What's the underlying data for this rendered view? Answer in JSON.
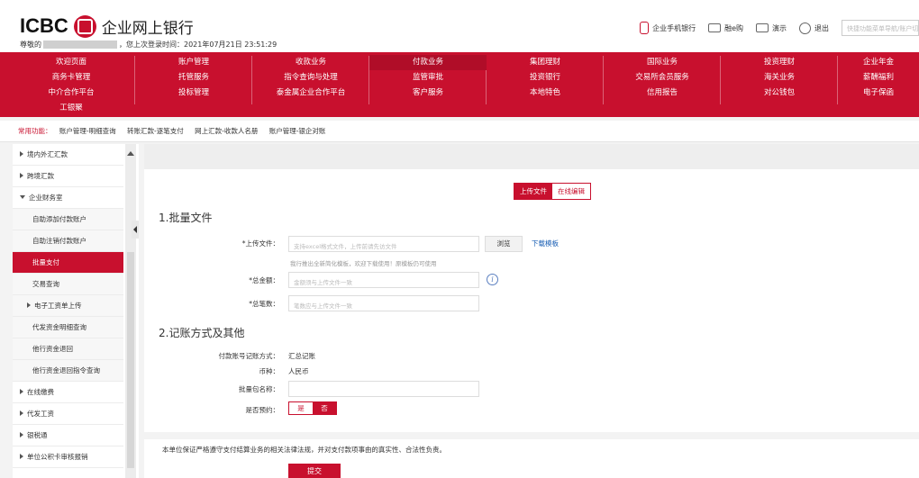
{
  "header": {
    "logo_en": "ICBC",
    "logo_cn": "企业网上银行",
    "greeting_prefix": "尊敬的",
    "last_login_text": "，您上次登录时间：2021年07月21日 23:51:29",
    "links": [
      {
        "label": "企业手机银行",
        "icon": "mobile-phone-icon"
      },
      {
        "label": "融e购",
        "icon": "mail-icon"
      },
      {
        "label": "演示",
        "icon": "demo-icon"
      },
      {
        "label": "退出",
        "icon": "power-icon"
      }
    ],
    "search_placeholder": "快捷功能菜单导航/账户切换"
  },
  "nav": {
    "rows": [
      [
        "欢迎页面",
        "账户管理",
        "收款业务",
        "付款业务",
        "集团理财",
        "国际业务",
        "投资理财",
        "企业年金"
      ],
      [
        "商务卡管理",
        "托管服务",
        "指令查询与处理",
        "监管审批",
        "投资银行",
        "交易所会员服务",
        "海关业务",
        "薪酬福利"
      ],
      [
        "中介合作平台",
        "投标管理",
        "泰金属企业合作平台",
        "客户服务",
        "本地特色",
        "信用报告",
        "对公钱包",
        "电子保函"
      ],
      [
        "工银聚"
      ]
    ],
    "active": "付款业务"
  },
  "quick": {
    "label": "常用功能：",
    "items": [
      "账户管理-明细查询",
      "转账汇款-逐笔支付",
      "网上汇款-收款人名册",
      "账户管理-银企对账"
    ]
  },
  "sidebar": {
    "items": [
      {
        "label": "境内外汇汇款",
        "level": 0,
        "arrow": "right"
      },
      {
        "label": "跨境汇款",
        "level": 0,
        "arrow": "right"
      },
      {
        "label": "企业财务室",
        "level": 0,
        "arrow": "down"
      },
      {
        "label": "自助添加付款账户",
        "level": 1
      },
      {
        "label": "自助注销付款账户",
        "level": 1
      },
      {
        "label": "批量支付",
        "level": 1,
        "active": true
      },
      {
        "label": "交易查询",
        "level": 1
      },
      {
        "label": "电子工资单上传",
        "level": 1,
        "arrow": "right"
      },
      {
        "label": "代发资金明细查询",
        "level": 1
      },
      {
        "label": "他行资金退回",
        "level": 1
      },
      {
        "label": "他行资金退回指令查询",
        "level": 1
      },
      {
        "label": "在线缴费",
        "level": 0,
        "arrow": "right"
      },
      {
        "label": "代发工资",
        "level": 0,
        "arrow": "right"
      },
      {
        "label": "银税通",
        "level": 0,
        "arrow": "right"
      },
      {
        "label": "单位公积卡审核报销",
        "level": 0,
        "arrow": "right"
      }
    ]
  },
  "content": {
    "mode_tabs": [
      "上传文件",
      "在线编辑"
    ],
    "mode_active": "上传文件",
    "section1_title": "1.批量文件",
    "upload_label": "*上传文件：",
    "upload_placeholder": "支持excel格式文件，上传前请先访文件",
    "browse_label": "浏览",
    "download_template": "下载模板",
    "hint": "我行推出全新简化模板，欢迎下载使用！原模板仍可使用",
    "total_amount_label": "*总金额：",
    "total_amount_placeholder": "金额须与上传文件一致",
    "total_count_label": "*总笔数：",
    "total_count_placeholder": "笔数应与上传文件一致",
    "section2_title": "2.记账方式及其他",
    "booking_label": "付款账号记账方式：",
    "booking_value": "汇总记账",
    "currency_label": "币种：",
    "currency_value": "人民币",
    "batch_name_label": "批量包名称：",
    "batch_name_value": "",
    "reserve_label": "是否预约：",
    "reserve_options": [
      "是",
      "否"
    ],
    "reserve_active": "否",
    "disclaimer": "本单位保证严格遵守支付结算业务的相关法律法规，并对支付款项事由的真实性、合法性负责。",
    "submit_label": "提交"
  },
  "colors": {
    "brand": "#c8102e",
    "link": "#1a5fb4"
  }
}
